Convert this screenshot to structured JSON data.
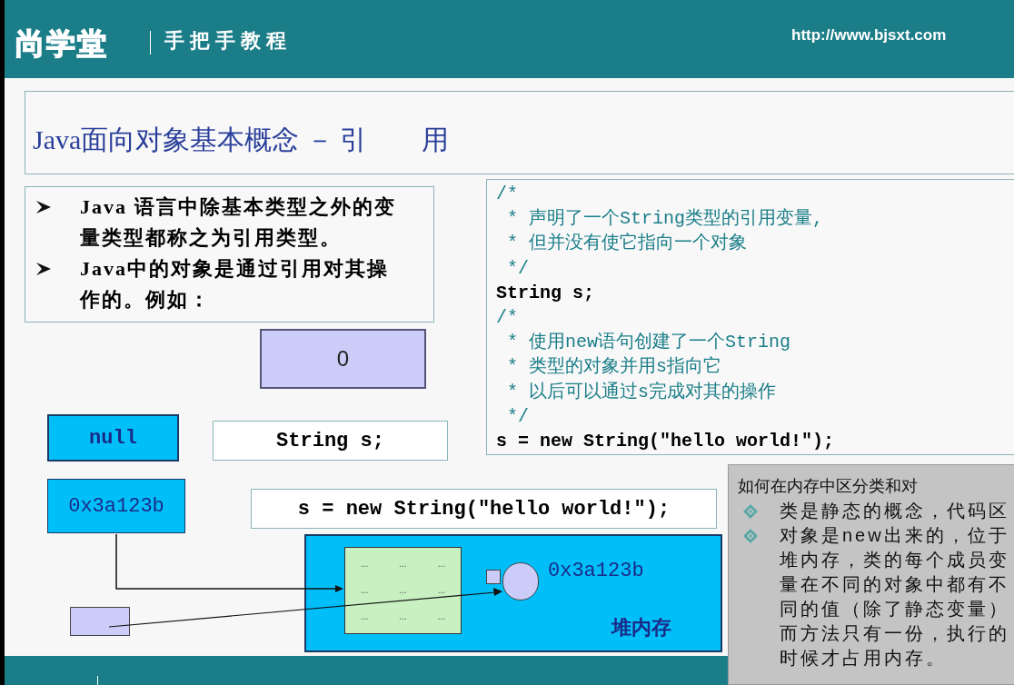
{
  "header": {
    "logo": "尚学堂",
    "tagline": "手把手教程",
    "url": "http://www.bjsxt.com"
  },
  "slide": {
    "title": "Java面向对象基本概念 － 引　　用",
    "bullets": [
      "Java 语言中除基本类型之外的变量类型都称之为引用类型。",
      "Java中的对象是通过引用对其操作的。例如："
    ],
    "code_lines": [
      {
        "kind": "comment",
        "text": "/*"
      },
      {
        "kind": "comment",
        "text": " * 声明了一个String类型的引用变量,"
      },
      {
        "kind": "comment",
        "text": " * 但并没有使它指向一个对象"
      },
      {
        "kind": "comment",
        "text": " */"
      },
      {
        "kind": "code",
        "text": "String s;"
      },
      {
        "kind": "comment",
        "text": "/*"
      },
      {
        "kind": "comment",
        "text": " * 使用new语句创建了一个String"
      },
      {
        "kind": "comment",
        "text": " * 类型的对象并用s指向它"
      },
      {
        "kind": "comment",
        "text": " * 以后可以通过s完成对其的操作"
      },
      {
        "kind": "comment",
        "text": " */"
      },
      {
        "kind": "code",
        "text": "s = new String(\"hello world!\");"
      }
    ],
    "diagram": {
      "value_box": "0",
      "null_box": "null",
      "declaration": "String s;",
      "address_box": "0x3a123b",
      "assignment": "s = new String(\"hello world!\");",
      "object_address": "0x3a123b",
      "heap_label": "堆内存",
      "cell_marks": [
        "...",
        "...",
        "...",
        "...",
        "...",
        "...",
        "...",
        "...",
        "..."
      ]
    }
  },
  "note": {
    "heading": "如何在内存中区分类和对",
    "items": [
      "类是静态的概念，代码区",
      "对象是new出来的，位于堆内存，类的每个成员变量在不同的对象中都有不同的值（除了静态变量）而方法只有一份，执行的时候才占用内存。"
    ]
  }
}
